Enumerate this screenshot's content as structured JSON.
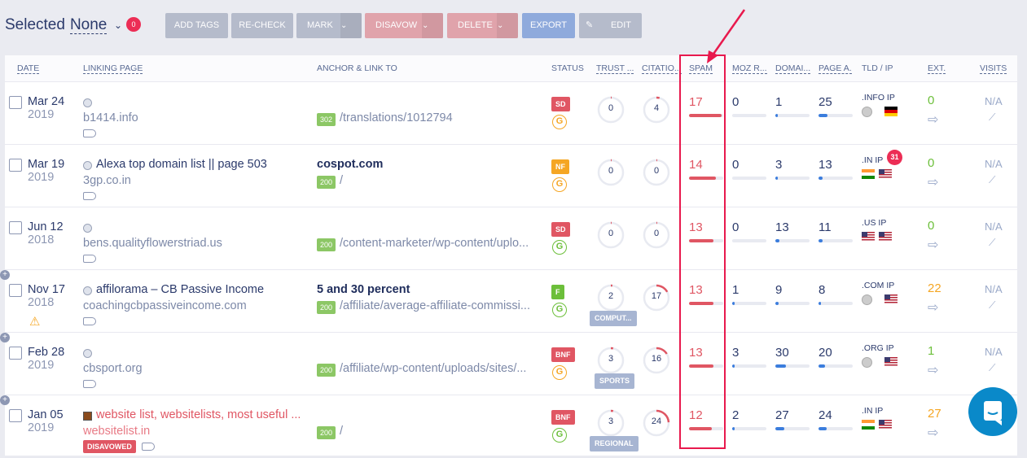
{
  "toolbar": {
    "selected_label": "Selected",
    "selected_value": "None",
    "count": "0",
    "buttons": {
      "add_tags": "ADD TAGS",
      "recheck": "RE-CHECK",
      "mark": "MARK",
      "disavow": "DISAVOW",
      "delete": "DELETE",
      "export": "EXPORT",
      "edit": "EDIT"
    }
  },
  "columns": {
    "date": "DATE",
    "linking": "LINKING PAGE",
    "anchor": "ANCHOR & LINK TO",
    "status": "STATUS",
    "trust": "TRUST ...",
    "citation": "CITATIO...",
    "spam": "SPAM",
    "moz": "MOZ R...",
    "domain": "DOMAI...",
    "page": "PAGE A.",
    "tld": "TLD / IP",
    "ext": "EXT.",
    "visits": "VISITS"
  },
  "colors": {
    "highlight": "#e8194d",
    "spam": "#e05663",
    "green": "#6cbf3a",
    "orange": "#f5a623"
  },
  "rows": [
    {
      "date": "Mar 24",
      "year": "2019",
      "title": "",
      "domain": "b1414.info",
      "anchor": "",
      "code": "302",
      "url": "/translations/1012794",
      "status": "SD",
      "status_color": "#e05663",
      "g_color": "#f5a623",
      "trust": 0,
      "citation": 4,
      "category": "",
      "spam": 17,
      "moz": 0,
      "domain_auth": 1,
      "page_auth": 25,
      "tld": ".INFO IP",
      "flags": [
        "globe",
        "de"
      ],
      "ip_count": "",
      "ext": "0",
      "ext_color": "#6cbf3a",
      "visits": "N/A",
      "plus": false,
      "warning": false,
      "disavowed": ""
    },
    {
      "date": "Mar 19",
      "year": "2019",
      "title": "Alexa top domain list || page 503",
      "domain": "3gp.co.in",
      "anchor": "cospot.com",
      "code": "200",
      "url": "/",
      "status": "NF",
      "status_color": "#f5a623",
      "g_color": "#f5a623",
      "trust": 0,
      "citation": 0,
      "category": "",
      "spam": 14,
      "moz": 0,
      "domain_auth": 3,
      "page_auth": 13,
      "tld": ".IN  IP",
      "flags": [
        "in",
        "us"
      ],
      "ip_count": "31",
      "ext": "0",
      "ext_color": "#6cbf3a",
      "visits": "N/A",
      "plus": false,
      "warning": false,
      "disavowed": ""
    },
    {
      "date": "Jun 12",
      "year": "2018",
      "title": "",
      "domain": "bens.qualityflowerstriad.us",
      "anchor": "",
      "code": "200",
      "url": "/content-marketer/wp-content/uplo...",
      "status": "SD",
      "status_color": "#e05663",
      "g_color": "#6cbf3a",
      "trust": 0,
      "citation": 0,
      "category": "",
      "spam": 13,
      "moz": 0,
      "domain_auth": 13,
      "page_auth": 11,
      "tld": ".US  IP",
      "flags": [
        "us",
        "us"
      ],
      "ip_count": "",
      "ext": "0",
      "ext_color": "#6cbf3a",
      "visits": "N/A",
      "plus": false,
      "warning": false,
      "disavowed": ""
    },
    {
      "date": "Nov 17",
      "year": "2018",
      "title": "affilorama – CB Passive Income",
      "domain": "coachingcbpassiveincome.com",
      "anchor": "5 and 30 percent",
      "code": "200",
      "url": "/affiliate/average-affiliate-commissi...",
      "status": "F",
      "status_color": "#6cbf3a",
      "g_color": "#6cbf3a",
      "trust": 2,
      "citation": 17,
      "category": "COMPUT...",
      "spam": 13,
      "moz": 1,
      "domain_auth": 9,
      "page_auth": 8,
      "tld": ".COM IP",
      "flags": [
        "globe",
        "us"
      ],
      "ip_count": "",
      "ext": "22",
      "ext_color": "#f5a623",
      "visits": "N/A",
      "plus": true,
      "warning": true,
      "disavowed": ""
    },
    {
      "date": "Feb 28",
      "year": "2019",
      "title": "",
      "domain": "cbsport.org",
      "anchor": "",
      "code": "200",
      "url": "/affiliate/wp-content/uploads/sites/...",
      "status": "BNF",
      "status_color": "#e05663",
      "g_color": "#f5a623",
      "trust": 3,
      "citation": 16,
      "category": "SPORTS",
      "spam": 13,
      "moz": 3,
      "domain_auth": 30,
      "page_auth": 20,
      "tld": ".ORG IP",
      "flags": [
        "globe",
        "us"
      ],
      "ip_count": "",
      "ext": "1",
      "ext_color": "#6cbf3a",
      "visits": "N/A",
      "plus": true,
      "warning": false,
      "disavowed": ""
    },
    {
      "date": "Jan 05",
      "year": "2019",
      "title": "website list, websitelists, most useful ...",
      "domain": "websitelist.in",
      "anchor": "",
      "code": "200",
      "url": "/",
      "status": "BNF",
      "status_color": "#e05663",
      "g_color": "#6cbf3a",
      "trust": 3,
      "citation": 24,
      "category": "REGIONAL",
      "spam": 12,
      "moz": 2,
      "domain_auth": 27,
      "page_auth": 24,
      "tld": ".IN  IP",
      "flags": [
        "in",
        "us"
      ],
      "ip_count": "",
      "ext": "27",
      "ext_color": "#f5a623",
      "visits": "",
      "plus": true,
      "warning": false,
      "disavowed": "DISAVOWED",
      "red": true
    }
  ]
}
